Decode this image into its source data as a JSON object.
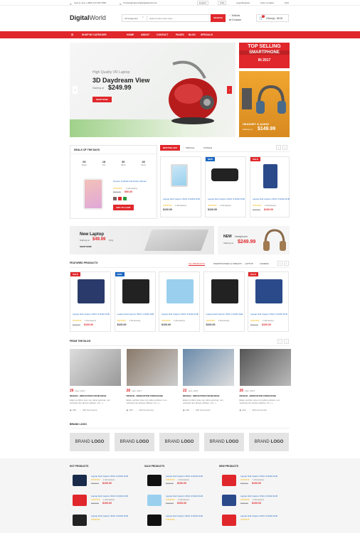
{
  "topbar": {
    "call": "Call us now: (+800) 123 456 7890",
    "contact": "Contact@support@digitalworld.com",
    "language": "English",
    "currency": "USD",
    "login": "Login/Register",
    "store": "Store Location",
    "faq": "FAQ"
  },
  "header": {
    "logo_bold": "Digital",
    "logo_light": "World",
    "category": "All Categories",
    "search_placeholder": "Search entire store here...",
    "search_btn": "SEARCH",
    "wishlist": "Wishlist",
    "compare": "Compare",
    "cart_count": "0",
    "cart_label": "0 item(s) - $0.00"
  },
  "nav": {
    "shop_by": "SHOP BY CATEGORY",
    "items": [
      "HOME",
      "ABOUT",
      "CONTACT",
      "PAGES",
      "BLOG",
      "SPECIALS"
    ]
  },
  "hero": {
    "subtitle": "High Quality VR Laptop",
    "title": "3D Daydream View",
    "starting": "Starting at",
    "price": "$249.99",
    "btn": "SHOP NOW"
  },
  "side_banners": {
    "top_line1": "TOP SELLING",
    "top_line2": "SMARTPHONE",
    "top_line3": "IN 2017",
    "bottom_title": "HEADSET & AUDIO",
    "bottom_starting": "Starting at",
    "bottom_price": "$149.99"
  },
  "deals": {
    "title": "DEALS OF THE DAYS",
    "counter": [
      {
        "v": "00",
        "l": "Days"
      },
      {
        "v": "18",
        "l": "Hrs"
      },
      {
        "v": "30",
        "l": "Mins"
      },
      {
        "v": "46",
        "l": "Secs"
      }
    ],
    "product_name": "Tempor Incididunt Et Dolore Mouse",
    "reviews": "1 Review(s)",
    "old": "$100.00",
    "price": "$50.00",
    "btn": "ADD TO CART"
  },
  "tabs1": {
    "items": [
      "BESTSELLER",
      "SPECIAL",
      "ONSALE"
    ]
  },
  "bestseller": [
    {
      "badge": "",
      "name": "Laptop Dell Inspiron 3521 i3 RAM 4GB",
      "reviews": "1 Review(s)",
      "old": "",
      "price": "$100.00"
    },
    {
      "badge": "NEW",
      "name": "Laptop Dell Inspiron 3521 i3 RAM 4GB",
      "reviews": "1 Review(s)",
      "old": "",
      "price": "$100.00"
    },
    {
      "badge": "SALE",
      "name": "Laptop Dell Inspiron 3521 i3 RAM 4GB",
      "reviews": "1 Review(s)",
      "old": "$200.00",
      "price": "$100.00"
    }
  ],
  "mid_banners": {
    "left_title": "New Laptop",
    "left_starting": "Starting at",
    "left_price": "$49.99",
    "left_only": "Only",
    "left_btn": "SHOP NOW",
    "right_new": "NEW",
    "right_sub": "Headphone",
    "right_starting": "Starting at",
    "right_price": "$249.99"
  },
  "featured": {
    "title": "FEATURED PRODUCTS",
    "tabs": [
      "ALL PRODUCTS",
      "SMARTPHONES & TABLETS",
      "LAPTOP",
      "CAMERA"
    ]
  },
  "featured_items": [
    {
      "badge": "SALE",
      "name": "Laptop Dell Inspiron 3521 i3 RAM 4GB",
      "reviews": "1 Review(s)",
      "old": "$200.00",
      "price": "$100.00"
    },
    {
      "badge": "NEW",
      "name": "Laptop Dell Inspiron 3521 i3 RAM 4GB",
      "reviews": "1 Review(s)",
      "old": "",
      "price": "$100.00"
    },
    {
      "badge": "",
      "name": "Laptop Dell Inspiron 3521 i3 RAM 4GB",
      "reviews": "1 Review(s)",
      "old": "",
      "price": "$100.00"
    },
    {
      "badge": "",
      "name": "Laptop Dell Inspiron 3521 i3 RAM 4GB",
      "reviews": "1 Review(s)",
      "old": "",
      "price": "$100.00"
    },
    {
      "badge": "SALE",
      "name": "Laptop Dell Inspiron 3521 i3 RAM 4GB",
      "reviews": "1 Review(s)",
      "old": "$200.00",
      "price": "$100.00"
    }
  ],
  "blog": {
    "title": "FROM THE BLOG",
    "posts": [
      {
        "day": "26",
        "month": "Dec, 2017",
        "title": "DESIGN - INNOVATION FROM EDGE",
        "text": "Etiam porttitor ante non tellus pulvinar, non vehicula nisi ultrices efficitur. Ut [...]",
        "views": "200",
        "comments": "200 Comments"
      },
      {
        "day": "28",
        "month": "Dec, 2017",
        "title": "DESIGN - INNOVATION FROM EDGE",
        "text": "Etiam porttitor ante non tellus pulvinar, non vehicula nisi ultrices efficitur. Ut [...]",
        "views": "200",
        "comments": "200 Comments"
      },
      {
        "day": "22",
        "month": "Dec, 2017",
        "title": "DESIGN - INNOVATION FROM EDGE",
        "text": "Etiam porttitor ante non tellus pulvinar, non vehicula nisi ultrices efficitur. Ut [...]",
        "views": "200",
        "comments": "200 Comments"
      },
      {
        "day": "26",
        "month": "Dec, 2017",
        "title": "DESIGN - INNOVATION FROM EDGE",
        "text": "Etiam porttitor ante non tellus pulvinar, non vehicula nisi ultrices efficitur. Ut [...]",
        "views": "200",
        "comments": "200 Comments"
      }
    ]
  },
  "brand": {
    "title": "BRAND LOGO",
    "logos": [
      {
        "a": "BRAND",
        "b": "LOGO"
      },
      {
        "a": "BRAND",
        "b": "LOGO"
      },
      {
        "a": "BRAND",
        "b": "LOGO"
      },
      {
        "a": "BRAND",
        "b": "LOGO"
      },
      {
        "a": "BRAND",
        "b": "LOGO"
      }
    ]
  },
  "bottom_lists": [
    {
      "title": "HOT PRODUCTS",
      "items": [
        {
          "name": "Laptop Dell Inspiron 3521 i3 RAM 4GB",
          "reviews": "1 Review(s)",
          "old": "$200.00",
          "price": "$100.00"
        },
        {
          "name": "Laptop Dell Inspiron 3521 i3 RAM 4GB",
          "reviews": "1 Review(s)",
          "old": "$200.00",
          "price": "$100.00"
        },
        {
          "name": "Laptop Dell Inspiron 3521 i3 RAM 4GB",
          "reviews": "",
          "old": "",
          "price": ""
        }
      ]
    },
    {
      "title": "SALE PRODUCTS",
      "items": [
        {
          "name": "Laptop Dell Inspiron 3521 i3 RAM 4GB",
          "reviews": "1 Review(s)",
          "old": "$200.00",
          "price": "$100.00"
        },
        {
          "name": "Laptop Dell Inspiron 3521 i3 RAM 4GB",
          "reviews": "1 Review(s)",
          "old": "$200.00",
          "price": "$100.00"
        },
        {
          "name": "Laptop Dell Inspiron 3521 i3 RAM 4GB",
          "reviews": "",
          "old": "",
          "price": ""
        }
      ]
    },
    {
      "title": "NEW PRODUCTS",
      "items": [
        {
          "name": "Laptop Dell Inspiron 3521 i3 RAM 4GB",
          "reviews": "1 Review(s)",
          "old": "$200.00",
          "price": "$100.00"
        },
        {
          "name": "Laptop Dell Inspiron 3521 i3 RAM 4GB",
          "reviews": "1 Review(s)",
          "old": "$200.00",
          "price": "$100.00"
        },
        {
          "name": "Laptop Dell Inspiron 3521 i3 RAM 4GB",
          "reviews": "",
          "old": "",
          "price": ""
        }
      ]
    }
  ],
  "colors": {
    "accent": "#e0272b",
    "link": "#1a66c2"
  }
}
